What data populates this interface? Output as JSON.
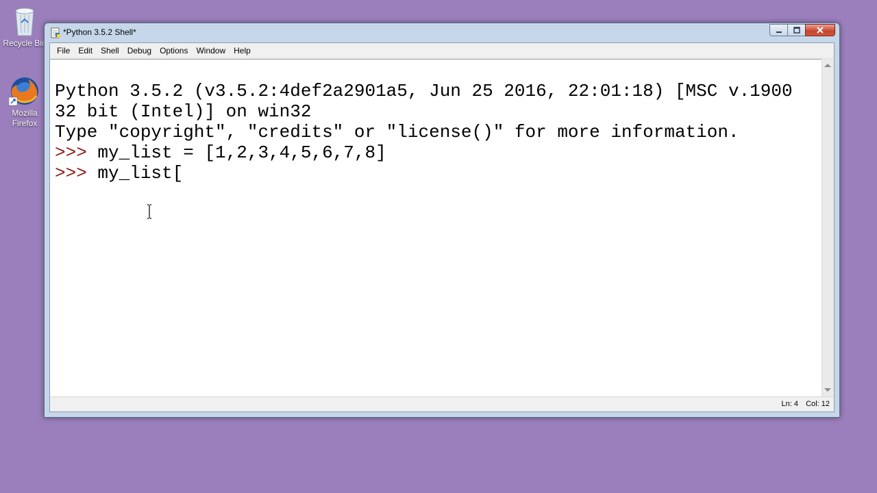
{
  "desktop": {
    "icons": [
      {
        "label": "Recycle Bin",
        "icon": "recycle-bin-icon"
      },
      {
        "label": "Mozilla Firefox",
        "icon": "firefox-icon"
      }
    ]
  },
  "window": {
    "title": "*Python 3.5.2 Shell*",
    "menu": [
      "File",
      "Edit",
      "Shell",
      "Debug",
      "Options",
      "Window",
      "Help"
    ],
    "console": {
      "banner_line1": "Python 3.5.2 (v3.5.2:4def2a2901a5, Jun 25 2016, 22:01:18) [MSC v.1900",
      "banner_line2": "32 bit (Intel)] on win32",
      "banner_line3": "Type \"copyright\", \"credits\" or \"license()\" for more information.",
      "prompt": ">>> ",
      "input1": "my_list = [1,2,3,4,5,6,7,8]",
      "input2": "my_list["
    },
    "status": {
      "ln": "Ln: 4",
      "col": "Col: 12"
    }
  },
  "colors": {
    "desktop": "#9b7fbd",
    "prompt": "#8b1a1a",
    "close_button": "#c7432f"
  }
}
